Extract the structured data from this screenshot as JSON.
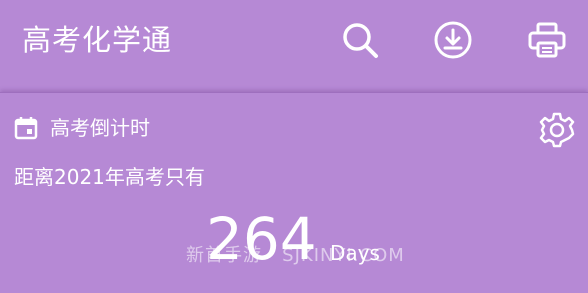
{
  "appbar": {
    "title": "高考化学通",
    "actions": [
      {
        "name": "search",
        "icon": "search-icon"
      },
      {
        "name": "download",
        "icon": "download-icon"
      },
      {
        "name": "print",
        "icon": "print-icon"
      }
    ]
  },
  "card": {
    "icon": "calendar-icon",
    "title": "高考倒计时",
    "settings_icon": "gear-icon",
    "subtitle": "距离2021年高考只有",
    "count": "264",
    "unit": "Days"
  },
  "watermark": "新首手游 · SJKINYI.COM",
  "colors": {
    "background": "#b689d5",
    "text": "#ffffff"
  }
}
